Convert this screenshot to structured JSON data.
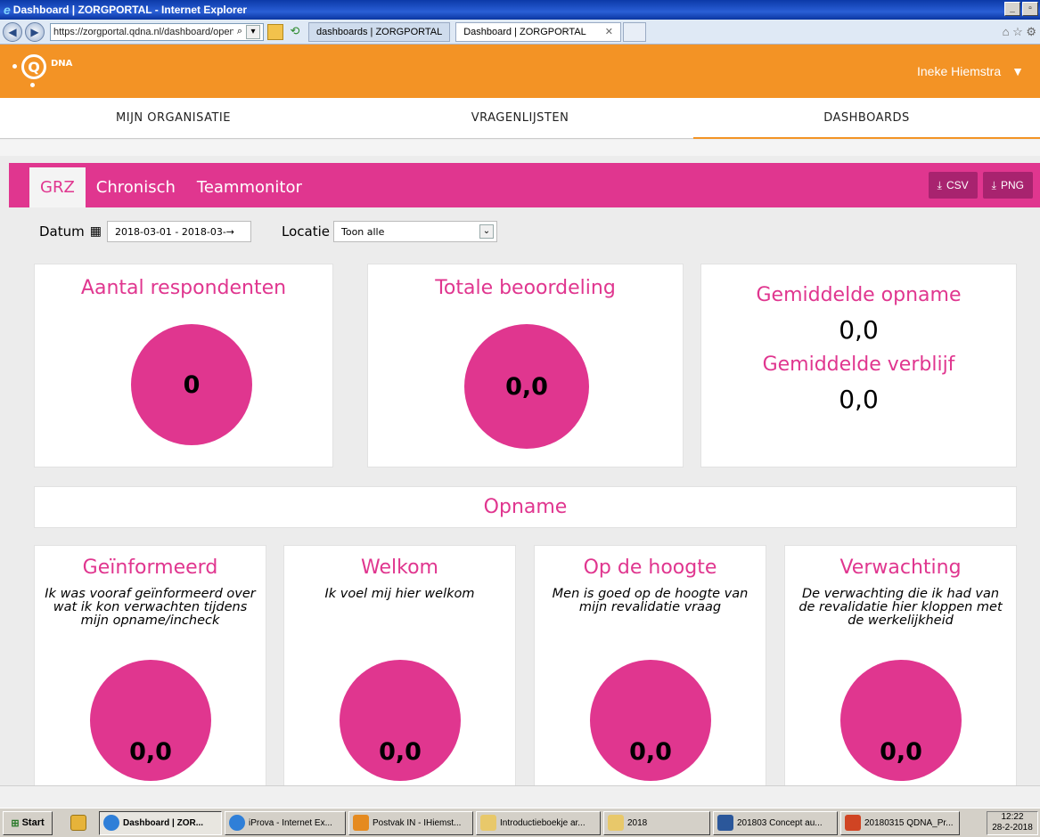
{
  "browser": {
    "window_title": "Dashboard | ZORGPORTAL - Internet Explorer",
    "url": "https://zorgportal.qdna.nl/dashboard/opensp",
    "tabs": [
      {
        "label": "dashboards | ZORGPORTAL"
      },
      {
        "label": "Dashboard | ZORGPORTAL"
      }
    ]
  },
  "site": {
    "logo_text": "DNA",
    "logo_letter": "Q",
    "user_name": "Ineke Hiemstra",
    "nav": [
      {
        "label": "MIJN ORGANISATIE"
      },
      {
        "label": "VRAGENLIJSTEN"
      },
      {
        "label": "DASHBOARDS"
      }
    ]
  },
  "dashboard": {
    "tabs": [
      {
        "label": "GRZ"
      },
      {
        "label": "Chronisch"
      },
      {
        "label": "Teammonitor"
      }
    ],
    "export_csv": "CSV",
    "export_png": "PNG",
    "filters": {
      "date_label": "Datum",
      "date_value": "2018-03-01 - 2018-03-→",
      "location_label": "Locatie",
      "location_value": "Toon alle"
    },
    "summary": {
      "respondents_title": "Aantal respondenten",
      "respondents_value": "0",
      "rating_title": "Totale beoordeling",
      "rating_value": "0,0",
      "avg_admission_title": "Gemiddelde opname",
      "avg_admission_value": "0,0",
      "avg_stay_title": "Gemiddelde verblijf",
      "avg_stay_value": "0,0"
    },
    "section_title": "Opname",
    "cards": [
      {
        "title": "Geïnformeerd",
        "question": "Ik was vooraf geïnformeerd over wat ik kon verwachten tijdens mijn opname/incheck",
        "value": "0,0"
      },
      {
        "title": "Welkom",
        "question": "Ik voel mij hier welkom",
        "value": "0,0"
      },
      {
        "title": "Op de hoogte",
        "question": "Men is goed op de hoogte van mijn revalidatie vraag",
        "value": "0,0"
      },
      {
        "title": "Verwachting",
        "question": "De verwachting die ik had van de revalidatie hier kloppen met de werkelijkheid",
        "value": "0,0"
      }
    ]
  },
  "taskbar": {
    "start_label": "Start",
    "items": [
      {
        "label": "Dashboard | ZOR..."
      },
      {
        "label": "iProva - Internet Ex..."
      },
      {
        "label": "Postvak IN - IHiemst..."
      },
      {
        "label": "Introductieboekje ar..."
      },
      {
        "label": "2018"
      },
      {
        "label": "201803 Concept au..."
      },
      {
        "label": "20180315 QDNA_Pr..."
      }
    ],
    "clock_time": "12:22",
    "clock_date": "28-2-2018"
  },
  "colors": {
    "brand_orange": "#f39325",
    "brand_pink": "#e0368f",
    "button_dark_pink": "#a8236f"
  }
}
